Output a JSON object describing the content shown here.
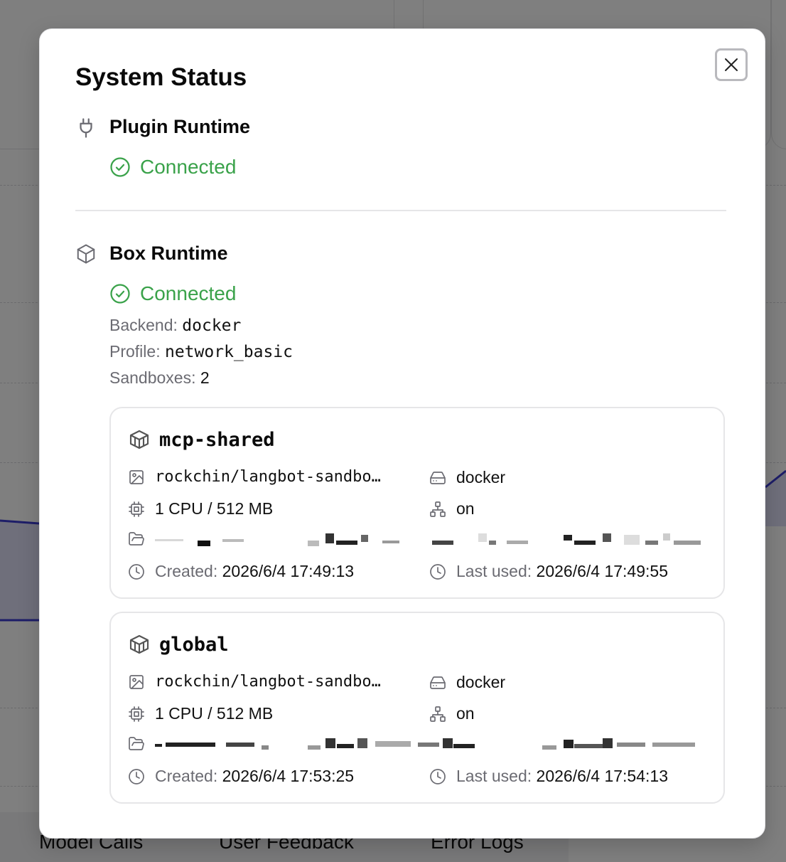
{
  "background": {
    "tabs": [
      "Model Calls",
      "User Feedback",
      "Error Logs"
    ]
  },
  "dialog": {
    "title": "System Status",
    "close_label": "Close",
    "plugin_runtime": {
      "title": "Plugin Runtime",
      "status": "Connected"
    },
    "box_runtime": {
      "title": "Box Runtime",
      "status": "Connected",
      "backend_label": "Backend:",
      "backend_value": "docker",
      "profile_label": "Profile:",
      "profile_value": "network_basic",
      "sandboxes_label": "Sandboxes:",
      "sandboxes_value": "2"
    },
    "sandboxes": [
      {
        "name": "mcp-shared",
        "image": "rockchin/langbot-sandbo…",
        "backend": "docker",
        "resources": "1 CPU / 512 MB",
        "network": "on",
        "created_label": "Created:",
        "created": "2026/6/4 17:49:13",
        "last_used_label": "Last used:",
        "last_used": "2026/6/4 17:49:55"
      },
      {
        "name": "global",
        "image": "rockchin/langbot-sandbo…",
        "backend": "docker",
        "resources": "1 CPU / 512 MB",
        "network": "on",
        "created_label": "Created:",
        "created": "2026/6/4 17:53:25",
        "last_used_label": "Last used:",
        "last_used": "2026/6/4 17:54:13"
      }
    ]
  },
  "colors": {
    "connected": "#3aa24a",
    "muted_text": "#6b6b72",
    "border": "#e6e6e8"
  }
}
